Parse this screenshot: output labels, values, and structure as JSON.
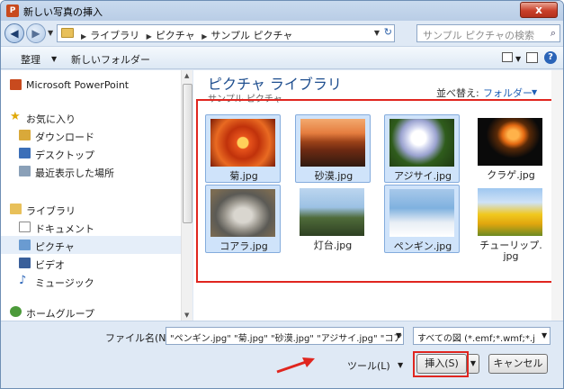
{
  "window": {
    "title": "新しい写真の挿入",
    "app_icon": "P",
    "close_label": "x"
  },
  "address": {
    "crumbs": [
      "ライブラリ",
      "ピクチャ",
      "サンプル ピクチャ"
    ],
    "search_placeholder": "サンプル ピクチャの検索"
  },
  "toolbar": {
    "organize": "整理",
    "new_folder": "新しいフォルダー"
  },
  "nav": {
    "powerpoint": "Microsoft PowerPoint",
    "favorites": "お気に入り",
    "downloads": "ダウンロード",
    "desktop": "デスクトップ",
    "recent": "最近表示した場所",
    "libraries": "ライブラリ",
    "documents": "ドキュメント",
    "pictures": "ピクチャ",
    "videos": "ビデオ",
    "music": "ミュージック",
    "homegroup": "ホームグループ"
  },
  "main": {
    "title": "ピクチャ ライブラリ",
    "subtitle": "サンプル ピクチャ",
    "arrange_label": "並べ替え:",
    "arrange_value": "フォルダー",
    "files": [
      {
        "name": "菊.jpg",
        "selected": true
      },
      {
        "name": "砂漠.jpg",
        "selected": true
      },
      {
        "name": "アジサイ.jpg",
        "selected": true
      },
      {
        "name": "クラゲ.jpg",
        "selected": false
      },
      {
        "name": "コアラ.jpg",
        "selected": true
      },
      {
        "name": "灯台.jpg",
        "selected": false
      },
      {
        "name": "ペンギン.jpg",
        "selected": true
      },
      {
        "name": "チューリップ.",
        "name2": "jpg",
        "selected": false
      }
    ]
  },
  "bottom": {
    "filename_label": "ファイル名(N):",
    "filename_value": "\"ペンギン.jpg\" \"菊.jpg\" \"砂漠.jpg\" \"アジサイ.jpg\" \"コアラ",
    "filter_value": "すべての図 (*.emf;*.wmf;*.j",
    "tools": "ツール(L)",
    "insert": "挿入(S)",
    "cancel": "キャンセル"
  },
  "colors": {
    "highlight": "#e0261f",
    "accent": "#1e4e8f",
    "link": "#1e5fb6"
  }
}
